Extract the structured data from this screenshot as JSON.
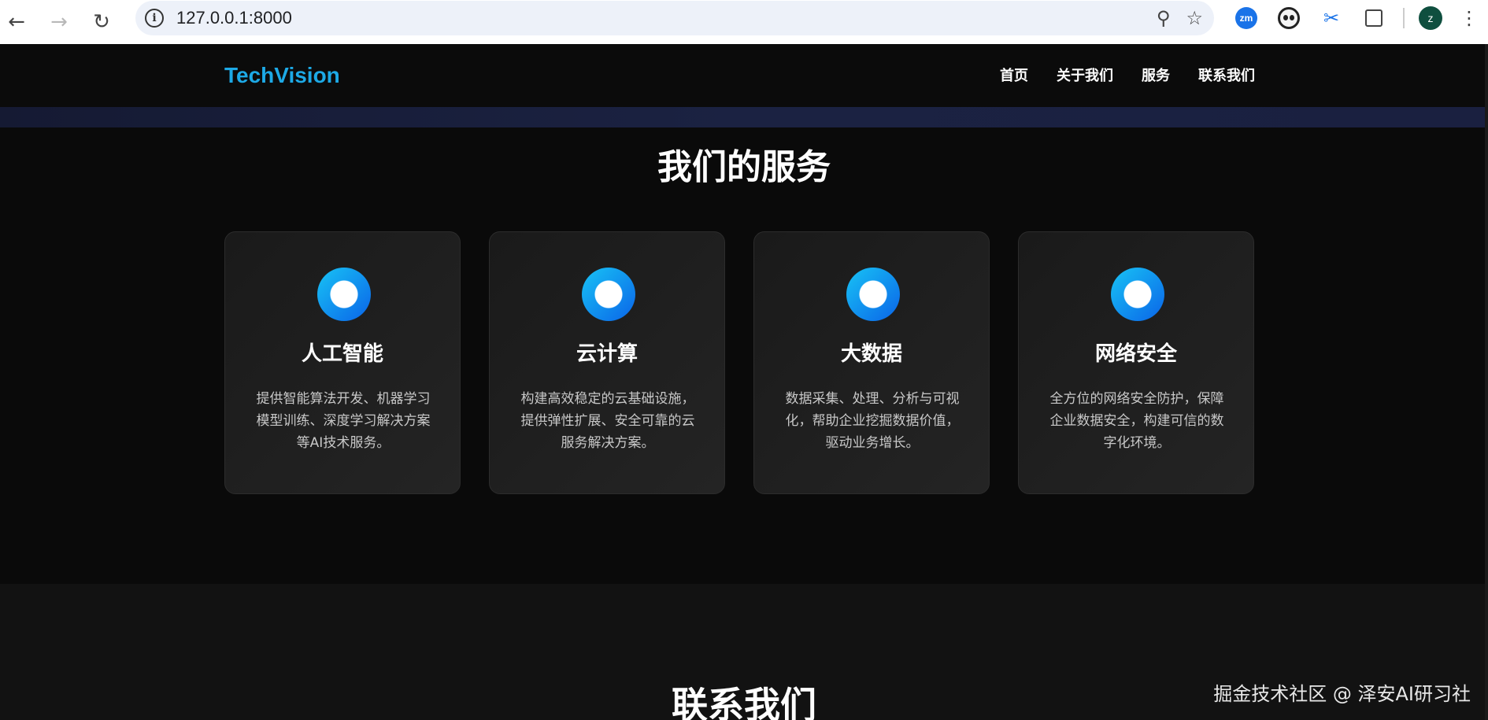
{
  "browser": {
    "url": "127.0.0.1:8000",
    "back_glyph": "←",
    "forward_glyph": "→",
    "reload_glyph": "↻",
    "info_glyph": "i",
    "zoom_glyph": "⚲",
    "star_glyph": "☆",
    "zm_label": "zm",
    "scissors_glyph": "✂",
    "avatar_initial": "z",
    "menu_glyph": "⋮"
  },
  "site": {
    "logo": "TechVision",
    "nav": [
      "首页",
      "关于我们",
      "服务",
      "联系我们"
    ]
  },
  "services": {
    "title": "我们的服务",
    "cards": [
      {
        "title": "人工智能",
        "desc": "提供智能算法开发、机器学习模型训练、深度学习解决方案等AI技术服务。"
      },
      {
        "title": "云计算",
        "desc": "构建高效稳定的云基础设施，提供弹性扩展、安全可靠的云服务解决方案。"
      },
      {
        "title": "大数据",
        "desc": "数据采集、处理、分析与可视化，帮助企业挖掘数据价值，驱动业务增长。"
      },
      {
        "title": "网络安全",
        "desc": "全方位的网络安全防护，保障企业数据安全，构建可信的数字化环境。"
      }
    ]
  },
  "contact": {
    "title": "联系我们"
  },
  "watermark": "掘金技术社区 @ 泽安AI研习社",
  "colors": {
    "accent": "#1da9e6",
    "page_bg": "#0a0a0a",
    "card_bg": "#1e1e1e"
  }
}
